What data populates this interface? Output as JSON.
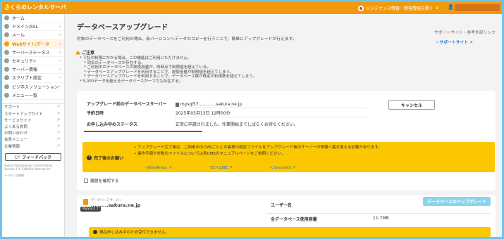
{
  "topbar": {
    "brand": "さくらのレンタルサーバ",
    "maintenance": "メンテナンス情報・障害情報を開く",
    "maintenance_chevron": "∨"
  },
  "sidebar": {
    "items": [
      {
        "label": "ホーム",
        "chevron": ""
      },
      {
        "label": "ドメイン/SSL",
        "chevron": "›"
      },
      {
        "label": "メール",
        "chevron": "›"
      },
      {
        "label": "Webサイト/データ",
        "chevron": "›"
      },
      {
        "label": "サーバーステータス",
        "chevron": "›"
      },
      {
        "label": "セキュリティ",
        "chevron": "›"
      },
      {
        "label": "サーバー情報",
        "chevron": "›"
      },
      {
        "label": "スクリプト設定",
        "chevron": "›"
      },
      {
        "label": "ビジネスソリューション",
        "chevron": "›"
      },
      {
        "label": "メニュー一覧",
        "chevron": ""
      }
    ],
    "links": [
      "サポート",
      "スタートアップガイド",
      "サービスサイト",
      "よくある質問",
      "お問い合わせ",
      "会員メニュー",
      "企業情報"
    ],
    "feedback": "フィードバック",
    "footer1": "Sakura Rentalserver Control Panel",
    "footer2": "Version 2 © SAKURA internet Inc.",
    "footer3": "ライセンス情報"
  },
  "main": {
    "title": "データベースアップグレード",
    "desc": "対象のデータベースをご利用の場合、新バージョンへデータのコピーを行うことで、簡単にアップグレードが行えます。",
    "support_title": "サポートサイト・参考外部リンク",
    "support_link": "サポートサイト",
    "notice_title": "ご注意",
    "notice": [
      "下記の制限にかかる場合、この機能はご利用いただけません。",
      "同名のデータベースが存在する。",
      "ご利用中のデータベースの総使用量が、既時点で制限値を超えている。",
      "データベースアップグレードを利用することで、総使用量が制限値を超えてしまう。",
      "データベースアップグレードを利用することで、データベース数が既定の利用数を超えてしまう。",
      "5,000データを超えるデータベースが一つでも存在する。"
    ],
    "info": {
      "db_label": "アップグレード前のデータベースサーバー",
      "db_value": "mysql57.............sakura.ne.jp",
      "date_label": "予約日時",
      "date_value": "2025年03月13日 12時00分",
      "status_label": "お申し込み中のステータス",
      "status_value": "正常に申請されました。作業開始までしばらくお待ちください。"
    },
    "cancel": "キャンセル",
    "caution_label": "完了後のお願い",
    "caution_1": "アップグレード完了後は、ご利用中のCMSごとにお客様の設定ファイルをアップグレード後のサーバーの情報へ書き換える必要があります。",
    "caution_2": "操作手順や対象のファイルについては各CMSのマニュアルページをご参照ください。",
    "cms": [
      "WordPress",
      "EC-CUBE",
      "Concrete5"
    ],
    "history": "履歴を確認する"
  },
  "db_card": {
    "label": "データベースサーバー",
    "name": "..........sakura.ne.jp",
    "badge": "MySQL5.7",
    "user_label": "ユーザー名",
    "usage_label": "全データベース使用容量",
    "usage_value": "11.7MB",
    "upgrade_btn": "データベースのアップグレード",
    "warning": "現在申し込み中のため受付できません。"
  }
}
